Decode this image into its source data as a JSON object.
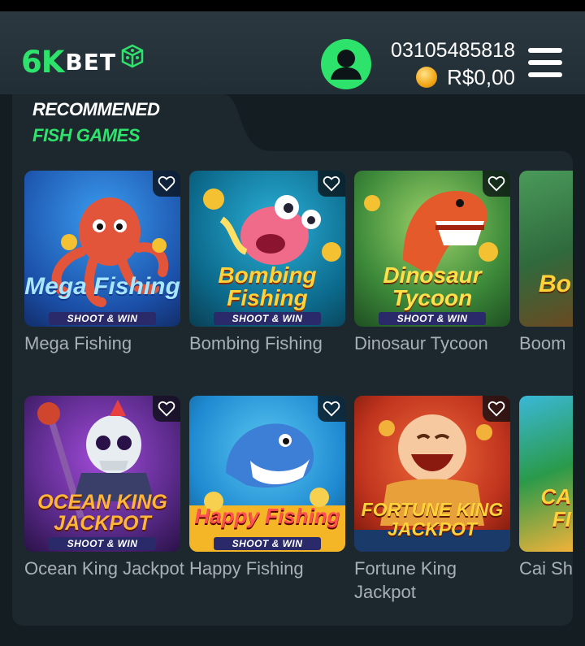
{
  "header": {
    "logo_main": "6K",
    "logo_sub": "BET",
    "phone": "03105485818",
    "balance": "R$0,00"
  },
  "section": {
    "title_line1": "RECOMMENED",
    "title_line2": "FISH GAMES"
  },
  "games": [
    {
      "name": "Mega Fishing",
      "art_title": "Mega Fishing",
      "art_tag": "SHOOT & WIN",
      "art_colors": [
        "#1e6fd8",
        "#e25a3a"
      ]
    },
    {
      "name": "Bombing Fishing",
      "art_title": "Bombing Fishing",
      "art_tag": "SHOOT & WIN",
      "art_colors": [
        "#0f6f8c",
        "#f28a28"
      ]
    },
    {
      "name": "Dinosaur Tycoon",
      "art_title": "Dinosaur Tycoon",
      "art_tag": "SHOOT & WIN",
      "art_colors": [
        "#3d8a3a",
        "#e15b2a"
      ]
    },
    {
      "name": "Boom",
      "art_title": "Bo",
      "art_colors": [
        "#2f6a3d",
        "#8a5a2a"
      ]
    },
    {
      "name": "Ocean King Jackpot",
      "art_title": "OCEAN KING JACKPOT",
      "art_tag": "SHOOT & WIN",
      "art_colors": [
        "#5a2a8a",
        "#d0452e"
      ]
    },
    {
      "name": "Happy Fishing",
      "art_title": "Happy Fishing",
      "art_tag": "SHOOT & WIN",
      "art_colors": [
        "#1f8ad1",
        "#f4b626"
      ]
    },
    {
      "name": "Fortune King Jackpot",
      "art_title": "FORTUNE KING JACKPOT",
      "art_colors": [
        "#c0341e",
        "#f2b23a"
      ]
    },
    {
      "name": "Cai Sh",
      "art_title": "CA FI",
      "art_colors": [
        "#2a9a4a",
        "#f2b23a"
      ]
    }
  ],
  "colors": {
    "accent": "#2ee36b",
    "background": "#141d22",
    "panel": "#1c282e"
  }
}
